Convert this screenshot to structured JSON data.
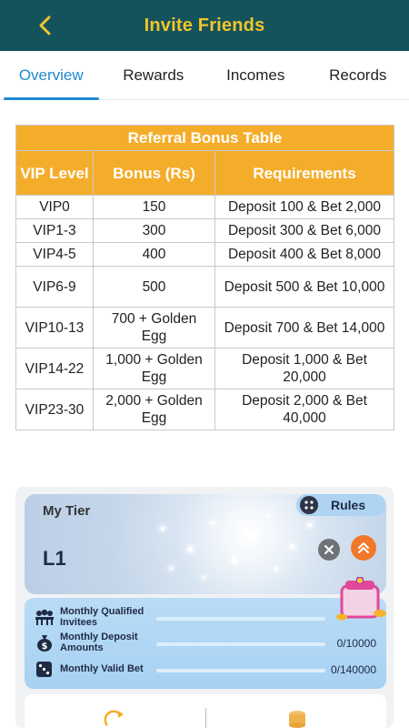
{
  "header": {
    "title": "Invite Friends",
    "back_icon": "chevron-left-icon"
  },
  "tabs": [
    {
      "label": "Overview",
      "active": true
    },
    {
      "label": "Rewards",
      "active": false
    },
    {
      "label": "Incomes",
      "active": false
    },
    {
      "label": "Records",
      "active": false
    }
  ],
  "table": {
    "title": "Referral Bonus Table",
    "headers": [
      "VIP Level",
      "Bonus (Rs)",
      "Requirements"
    ],
    "rows": [
      [
        "VIP0",
        "150",
        "Deposit 100 & Bet 2,000"
      ],
      [
        "VIP1-3",
        "300",
        "Deposit 300 & Bet 6,000"
      ],
      [
        "VIP4-5",
        "400",
        "Deposit 400 & Bet 8,000"
      ],
      [
        "VIP6-9",
        "500",
        "Deposit 500 & Bet 10,000"
      ],
      [
        "VIP10-13",
        "700 + Golden Egg",
        "Deposit 700 & Bet 14,000"
      ],
      [
        "VIP14-22",
        "1,000 + Golden Egg",
        "Deposit 1,000 & Bet 20,000"
      ],
      [
        "VIP23-30",
        "2,000 + Golden Egg",
        "Deposit 2,000 & Bet 40,000"
      ]
    ]
  },
  "tier": {
    "title": "My Tier",
    "level": "L1",
    "rules_label": "Rules",
    "stats": [
      {
        "label": "Monthly Qualified Invitees",
        "value": "",
        "progress": 0,
        "icon": "group-icon"
      },
      {
        "label": "Monthly Deposit Amounts",
        "value": "0/10000",
        "progress": 0,
        "icon": "money-bag-icon"
      },
      {
        "label": "Monthly Valid Bet",
        "value": "0/140000",
        "progress": 0,
        "icon": "dice-icon"
      }
    ]
  },
  "colors": {
    "header_bg": "#14535c",
    "header_title": "#f3c52a",
    "tab_active": "#1f8ad1",
    "table_header": "#f4ad2a",
    "accent_orange": "#f1782a"
  }
}
